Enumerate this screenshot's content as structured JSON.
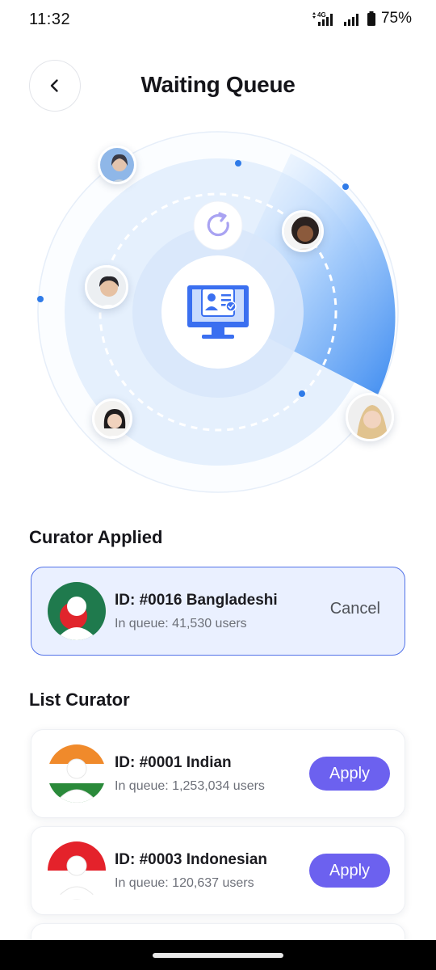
{
  "status_bar": {
    "time": "11:32",
    "network": "4G",
    "battery_percent": "75%"
  },
  "header": {
    "title": "Waiting Queue",
    "back_icon": "chevron-left-icon"
  },
  "radar": {
    "refresh_icon": "refresh-icon",
    "center_icon": "monitor-profile-icon",
    "colors": {
      "accent": "#3f8cf0",
      "icon_blue": "#3a6ff0",
      "refresh": "#a9a3f2"
    }
  },
  "curator_applied": {
    "title": "Curator Applied",
    "card": {
      "id_text": "ID: #0016 Bangladeshi",
      "queue_text": "In queue: 41,530 users",
      "action_label": "Cancel",
      "flag": "bangladesh"
    }
  },
  "list_curator": {
    "title": "List Curator",
    "items": [
      {
        "id_text": "ID: #0001 Indian",
        "queue_text": "In queue: 1,253,034 users",
        "action_label": "Apply",
        "flag": "india"
      },
      {
        "id_text": "ID: #0003 Indonesian",
        "queue_text": "In queue: 120,637 users",
        "action_label": "Apply",
        "flag": "indonesia"
      }
    ]
  },
  "colors": {
    "apply_button": "#6c61ef",
    "applied_border": "#5272e8",
    "applied_bg": "#eaf0ff"
  }
}
